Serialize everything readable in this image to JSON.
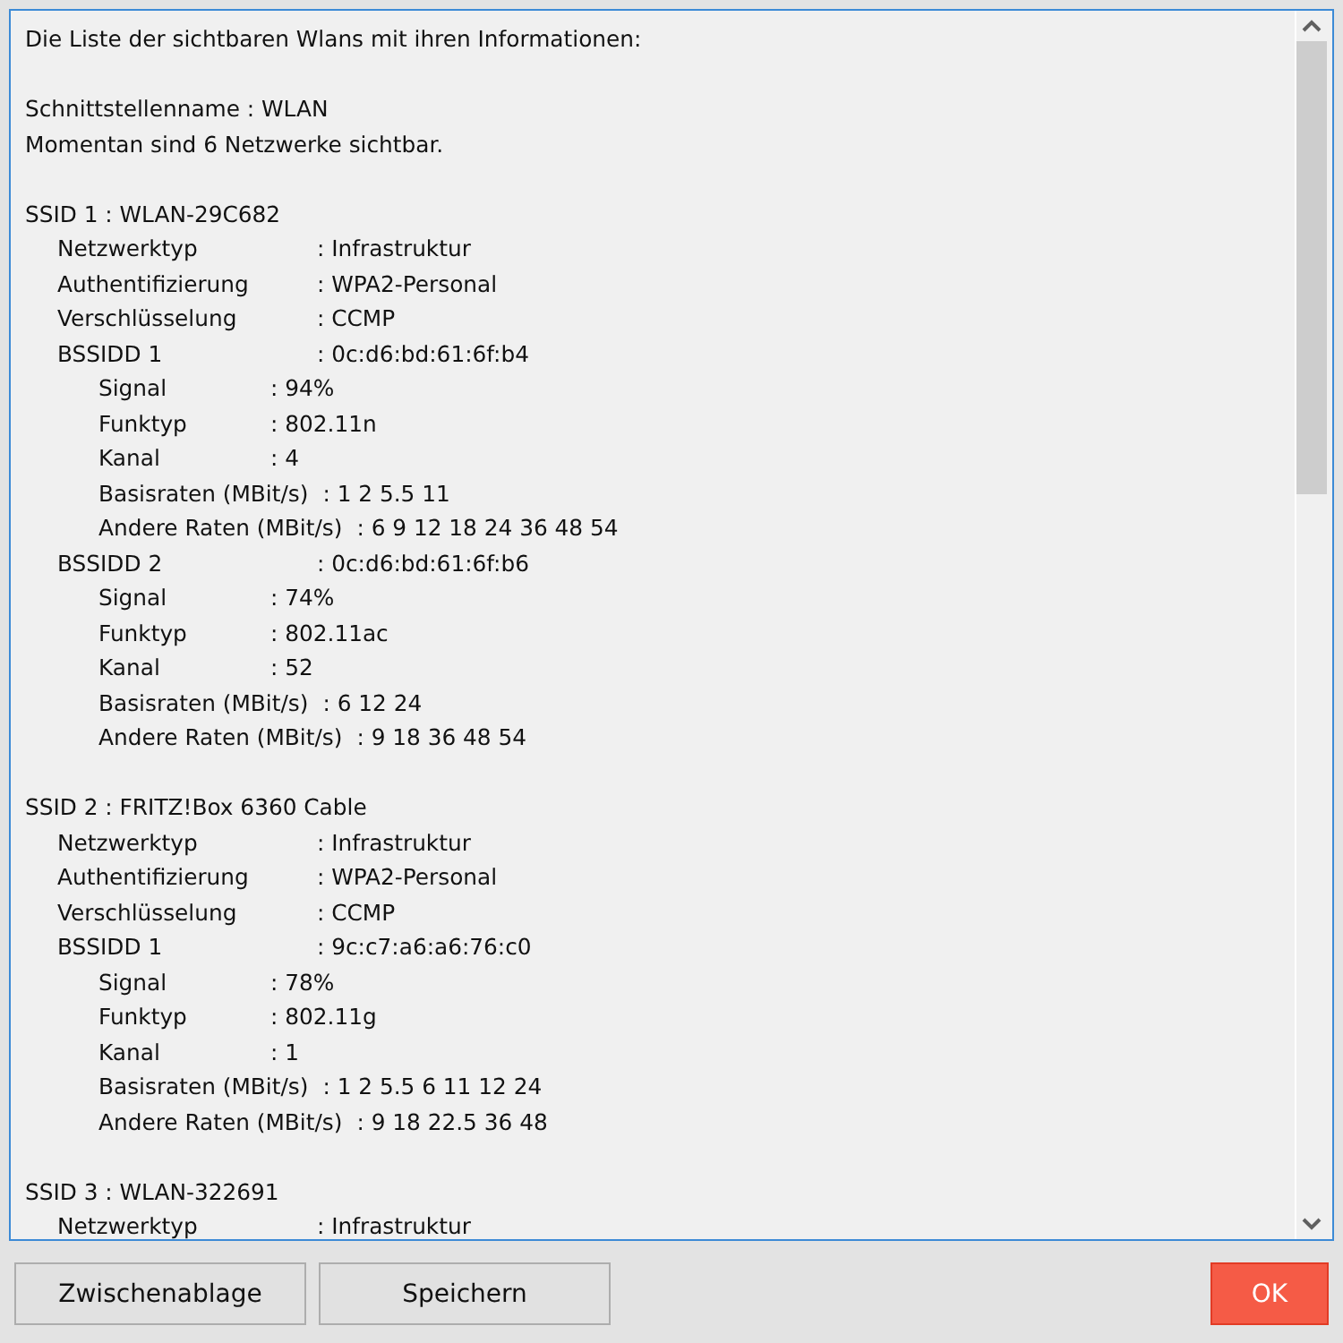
{
  "report": {
    "heading": "Die Liste der sichtbaren Wlans mit ihren Informationen:",
    "intro": [
      "Schnittstellenname : WLAN",
      "Momentan sind 6 Netzwerke sichtbar."
    ],
    "networks": [
      {
        "title": "SSID 1 : WLAN-29C682",
        "fields": [
          {
            "label": "Netzwerktyp",
            "value": ": Infrastruktur"
          },
          {
            "label": "Authentifizierung",
            "value": ": WPA2-Personal"
          },
          {
            "label": "Verschlüsselung",
            "value": ": CCMP"
          }
        ],
        "children": [
          {
            "label": "BSSIDD 1",
            "value": ": 0c:d6:bd:61:6f:b4",
            "children": [
              {
                "label": "Signal",
                "value": ": 94%"
              },
              {
                "label": "Funktyp",
                "value": ": 802.11n"
              },
              {
                "label": "Kanal",
                "value": ": 4"
              },
              {
                "label": "Basisraten (MBit/s)",
                "value": ": 1 2 5.5 11"
              },
              {
                "label": "Andere Raten (MBit/s)",
                "value": ": 6 9 12 18 24 36 48 54"
              }
            ]
          },
          {
            "label": "BSSIDD 2",
            "value": ": 0c:d6:bd:61:6f:b6",
            "children": [
              {
                "label": "Signal",
                "value": ": 74%"
              },
              {
                "label": "Funktyp",
                "value": ": 802.11ac"
              },
              {
                "label": "Kanal",
                "value": ": 52"
              },
              {
                "label": "Basisraten (MBit/s)",
                "value": ": 6 12 24"
              },
              {
                "label": "Andere Raten (MBit/s)",
                "value": ": 9 18 36 48 54"
              }
            ]
          }
        ]
      },
      {
        "title": "SSID 2 : FRITZ!Box 6360 Cable",
        "fields": [
          {
            "label": "Netzwerktyp",
            "value": ": Infrastruktur"
          },
          {
            "label": "Authentifizierung",
            "value": ": WPA2-Personal"
          },
          {
            "label": "Verschlüsselung",
            "value": ": CCMP"
          }
        ],
        "children": [
          {
            "label": "BSSIDD 1",
            "value": ": 9c:c7:a6:a6:76:c0",
            "children": [
              {
                "label": "Signal",
                "value": ": 78%"
              },
              {
                "label": "Funktyp",
                "value": ": 802.11g"
              },
              {
                "label": "Kanal",
                "value": ": 1"
              },
              {
                "label": "Basisraten (MBit/s)",
                "value": ": 1 2 5.5 6 11 12 24"
              },
              {
                "label": "Andere Raten (MBit/s)",
                "value": ": 9 18 22.5 36 48"
              }
            ]
          }
        ]
      },
      {
        "title": "SSID 3 : WLAN-322691",
        "fields": [
          {
            "label": "Netzwerktyp",
            "value": ": Infrastruktur"
          }
        ]
      }
    ]
  },
  "buttons": [
    {
      "label": "Zwischenablage",
      "kind": "plain"
    },
    {
      "label": "Speichern",
      "kind": "plain"
    },
    {
      "label": "OK",
      "kind": "primary"
    }
  ]
}
